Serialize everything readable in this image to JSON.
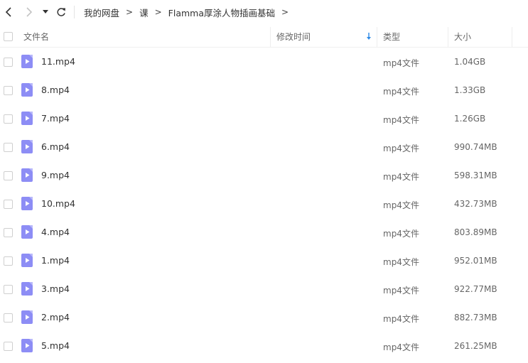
{
  "breadcrumb": [
    {
      "label": "我的网盘"
    },
    {
      "label": "课"
    },
    {
      "label": "Flamma厚涂人物插画基础"
    }
  ],
  "breadcrumb_separator": ">",
  "columns": {
    "name": "文件名",
    "modified": "修改时间",
    "type": "类型",
    "size": "大小"
  },
  "files": [
    {
      "name": "11.mp4",
      "type": "mp4文件",
      "size": "1.04GB"
    },
    {
      "name": "8.mp4",
      "type": "mp4文件",
      "size": "1.33GB"
    },
    {
      "name": "7.mp4",
      "type": "mp4文件",
      "size": "1.26GB"
    },
    {
      "name": "6.mp4",
      "type": "mp4文件",
      "size": "990.74MB"
    },
    {
      "name": "9.mp4",
      "type": "mp4文件",
      "size": "598.31MB"
    },
    {
      "name": "10.mp4",
      "type": "mp4文件",
      "size": "432.73MB"
    },
    {
      "name": "4.mp4",
      "type": "mp4文件",
      "size": "803.89MB"
    },
    {
      "name": "1.mp4",
      "type": "mp4文件",
      "size": "952.01MB"
    },
    {
      "name": "3.mp4",
      "type": "mp4文件",
      "size": "922.77MB"
    },
    {
      "name": "2.mp4",
      "type": "mp4文件",
      "size": "882.73MB"
    },
    {
      "name": "5.mp4",
      "type": "mp4文件",
      "size": "261.25MB"
    }
  ],
  "colors": {
    "video_icon": "#8d8df5",
    "sort_arrow": "#2e8ae6"
  }
}
